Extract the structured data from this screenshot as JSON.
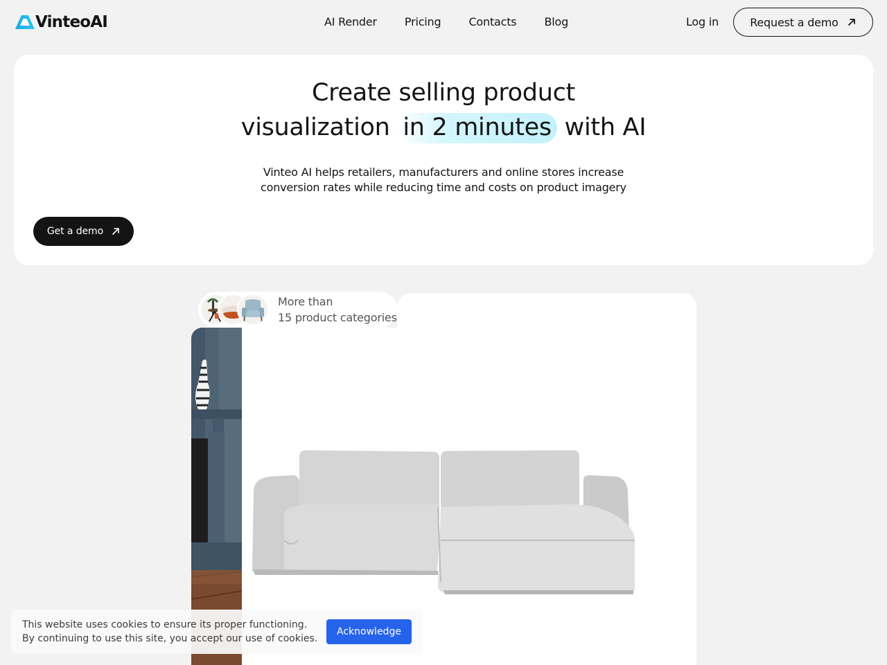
{
  "brand": {
    "name": "VinteoAI",
    "accent": "#1aa7e6"
  },
  "nav": {
    "items": [
      "AI Render",
      "Pricing",
      "Contacts",
      "Blog"
    ]
  },
  "header": {
    "login": "Log in",
    "request_demo": "Request a demo"
  },
  "hero": {
    "title_line1": "Create selling product",
    "title_line2_pre": "visualization",
    "title_highlight": "in 2 minutes",
    "title_line2_post": "with AI",
    "subtitle_line1": "Vinteo AI helps retailers, manufacturers and online stores increase",
    "subtitle_line2": "conversion rates while reducing time and costs on product imagery",
    "cta": "Get a demo"
  },
  "showcase": {
    "badge_line1": "More than",
    "badge_line2": "15 product categories",
    "thumbs": [
      "side-table-thumb",
      "pillow-thumb",
      "armchair-thumb"
    ]
  },
  "cookie": {
    "line1": "This website uses cookies to ensure its proper functioning.",
    "line2": "By continuing to use this site, you accept our use of cookies.",
    "button": "Acknowledge",
    "button_color": "#2563eb"
  }
}
